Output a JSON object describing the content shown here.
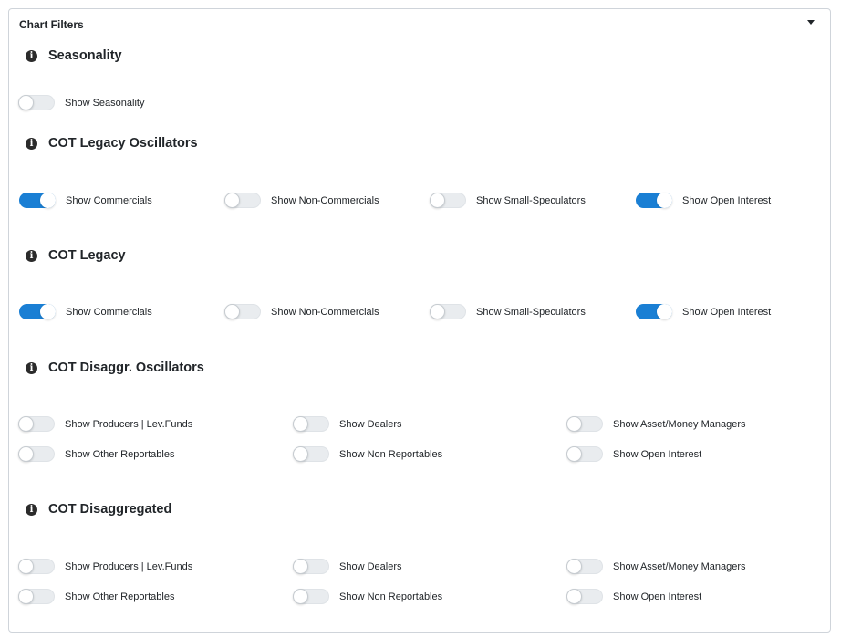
{
  "panel": {
    "title": "Chart Filters"
  },
  "accent_color": "#1a7fd4",
  "icons": {
    "info": "info-icon",
    "collapse": "caret-down-icon"
  },
  "sections": [
    {
      "title": "Seasonality",
      "toggles": [
        {
          "label": "Show Seasonality",
          "on": false
        }
      ]
    },
    {
      "title": "COT Legacy Oscillators",
      "toggles": [
        {
          "label": "Show Commercials",
          "on": true
        },
        {
          "label": "Show Non-Commercials",
          "on": false
        },
        {
          "label": "Show Small-Speculators",
          "on": false
        },
        {
          "label": "Show Open Interest",
          "on": true
        }
      ]
    },
    {
      "title": "COT Legacy",
      "toggles": [
        {
          "label": "Show Commercials",
          "on": true
        },
        {
          "label": "Show Non-Commercials",
          "on": false
        },
        {
          "label": "Show Small-Speculators",
          "on": false
        },
        {
          "label": "Show Open Interest",
          "on": true
        }
      ]
    },
    {
      "title": "COT Disaggr. Oscillators",
      "toggles": [
        {
          "label": "Show Producers | Lev.Funds",
          "on": false
        },
        {
          "label": "Show Dealers",
          "on": false
        },
        {
          "label": "Show Asset/Money Managers",
          "on": false
        },
        {
          "label": "Show Other Reportables",
          "on": false
        },
        {
          "label": "Show Non Reportables",
          "on": false
        },
        {
          "label": "Show Open Interest",
          "on": false
        }
      ]
    },
    {
      "title": "COT Disaggregated",
      "toggles": [
        {
          "label": "Show Producers | Lev.Funds",
          "on": false
        },
        {
          "label": "Show Dealers",
          "on": false
        },
        {
          "label": "Show Asset/Money Managers",
          "on": false
        },
        {
          "label": "Show Other Reportables",
          "on": false
        },
        {
          "label": "Show Non Reportables",
          "on": false
        },
        {
          "label": "Show Open Interest",
          "on": false
        }
      ]
    }
  ]
}
